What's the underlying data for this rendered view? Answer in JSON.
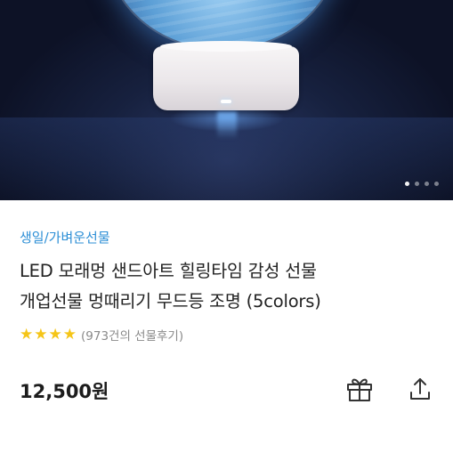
{
  "hero": {
    "carousel": {
      "total_slides": 4,
      "active_index": 0
    }
  },
  "product": {
    "category": "생일/가벼운선물",
    "title_line1": "LED 모래멍 샌드아트 힐링타임 감성 선물",
    "title_line2": "개업선물 멍때리기 무드등 조명 (5colors)",
    "rating_stars": 4,
    "review_text": "(973건의 선물후기)",
    "price": "12,500원"
  },
  "icons": {
    "star": "star-icon",
    "gift": "gift-icon",
    "share": "share-icon"
  },
  "colors": {
    "category": "#2d8fd6",
    "star": "#f5c518"
  }
}
